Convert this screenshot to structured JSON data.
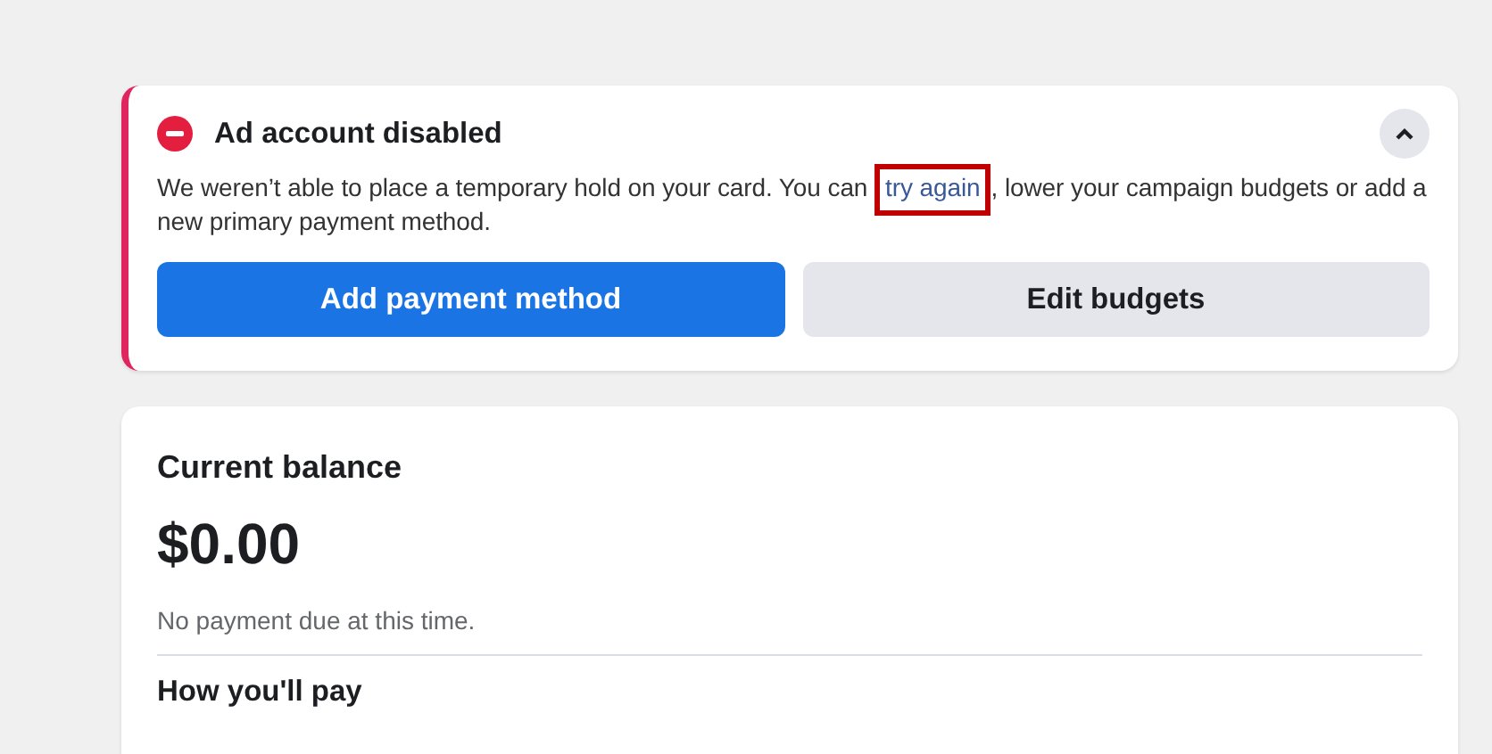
{
  "alert": {
    "title": "Ad account disabled",
    "message_before": "We weren’t able to place a temporary hold on your card. You can ",
    "link": "try again",
    "link_highlighted": true,
    "message_after": ", lower your campaign budgets or add a new primary payment method.",
    "buttons": [
      {
        "label": "Add payment method",
        "kind": "primary"
      },
      {
        "label": "Edit budgets",
        "kind": "secondary"
      }
    ]
  },
  "balance": {
    "title": "Current balance",
    "amount": "$0.00",
    "note": "No payment due at this time.",
    "section_title": "How you'll pay"
  }
}
